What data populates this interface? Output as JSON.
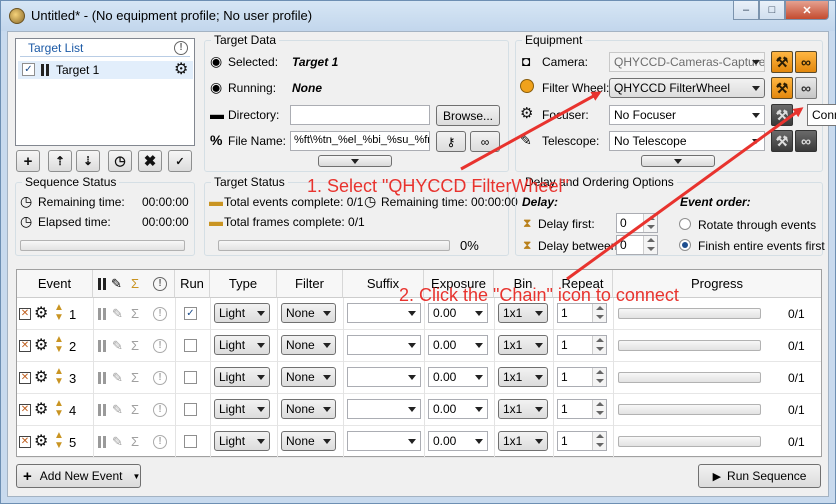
{
  "window": {
    "title": "Untitled* - (No equipment profile; No user profile)",
    "minimize_glyph": "–",
    "maximize_glyph": "□",
    "close_glyph": "✕"
  },
  "target_data": {
    "group_title": "Target Data",
    "selected_label": "Selected:",
    "selected_value": "Target 1",
    "running_label": "Running:",
    "running_value": "None",
    "directory_label": "Directory:",
    "directory_value": "",
    "browse_label": "Browse...",
    "filename_label": "File Name:",
    "filename_value": "%ft\\%tn_%el_%bi_%su_%fn"
  },
  "target_list": {
    "header": "Target List",
    "items": [
      {
        "label": "Target 1",
        "checked": true
      }
    ]
  },
  "equipment": {
    "group_title": "Equipment",
    "camera_label": "Camera:",
    "camera_value": "QHYCCD-Cameras-Capture",
    "filter_wheel_label": "Filter Wheel:",
    "filter_wheel_value": "QHYCCD FilterWheel",
    "focuser_label": "Focuser:",
    "focuser_value": "No Focuser",
    "telescope_label": "Telescope:",
    "telescope_value": "No Telescope",
    "tooltip": "Conn"
  },
  "sequence_status": {
    "group_title": "Sequence Status",
    "remaining_label": "Remaining time:",
    "remaining_value": "00:00:00",
    "elapsed_label": "Elapsed time:",
    "elapsed_value": "00:00:00",
    "progress": 0
  },
  "target_status": {
    "group_title": "Target Status",
    "total_events_label": "Total events complete: 0/1",
    "total_frames_label": "Total frames complete: 0/1",
    "remaining_label": "Remaining time: 00:00:00",
    "percent": "0%",
    "progress": 0
  },
  "delay_options": {
    "group_title": "Delay and Ordering Options",
    "delay_heading": "Delay:",
    "delay_first_label": "Delay first:",
    "delay_first_value": "0",
    "delay_between_label": "Delay between:",
    "delay_between_value": "0",
    "order_heading": "Event order:",
    "rotate_label": "Rotate through events",
    "finish_label": "Finish entire events first",
    "selected_order": "finish"
  },
  "table": {
    "headers": {
      "event": "Event",
      "run": "Run",
      "type": "Type",
      "filter": "Filter",
      "suffix": "Suffix",
      "exposure": "Exposure",
      "bin": "Bin",
      "repeat": "Repeat",
      "progress": "Progress"
    },
    "rows": [
      {
        "num": "1",
        "run": true,
        "type": "Light",
        "filter": "None",
        "suffix": "",
        "exposure": "0.00",
        "bin": "1x1",
        "repeat": "1",
        "progress_text": "0/1"
      },
      {
        "num": "2",
        "run": false,
        "type": "Light",
        "filter": "None",
        "suffix": "",
        "exposure": "0.00",
        "bin": "1x1",
        "repeat": "1",
        "progress_text": "0/1"
      },
      {
        "num": "3",
        "run": false,
        "type": "Light",
        "filter": "None",
        "suffix": "",
        "exposure": "0.00",
        "bin": "1x1",
        "repeat": "1",
        "progress_text": "0/1"
      },
      {
        "num": "4",
        "run": false,
        "type": "Light",
        "filter": "None",
        "suffix": "",
        "exposure": "0.00",
        "bin": "1x1",
        "repeat": "1",
        "progress_text": "0/1"
      },
      {
        "num": "5",
        "run": false,
        "type": "Light",
        "filter": "None",
        "suffix": "",
        "exposure": "0.00",
        "bin": "1x1",
        "repeat": "1",
        "progress_text": "0/1"
      }
    ]
  },
  "footer": {
    "add_event_label": "Add New Event",
    "run_sequence_label": "Run Sequence"
  },
  "annotations": {
    "step1": "1. Select \"QHYCCD FilterWheel\"",
    "step2": "2. Click the \"Chain\" icon to connect",
    "color": "#e8332e"
  }
}
